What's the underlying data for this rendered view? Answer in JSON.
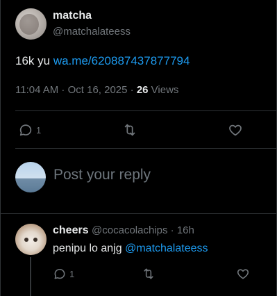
{
  "post": {
    "display_name": "matcha",
    "handle": "@matchalateess",
    "text": "16k yu",
    "link": "wa.me/620887437877794",
    "timestamp": "11:04 AM · Oct 16, 2025 · ",
    "views_count": "26",
    "views_label": " Views",
    "reply_count": "1"
  },
  "reply_box": {
    "placeholder": "Post your reply"
  },
  "reply": {
    "display_name": "cheers",
    "handle": "@cocacolachips",
    "separator": " · ",
    "time": "16h",
    "text": "penipu lo anjg ",
    "mention": "@matchalateess",
    "reply_count": "1"
  },
  "icons": {
    "reply": "speech-bubble-icon",
    "repost": "repost-icon",
    "like": "heart-icon"
  },
  "colors": {
    "background": "#000000",
    "link": "#1d9bf0",
    "muted": "#71767b",
    "divider": "#2f3336"
  }
}
